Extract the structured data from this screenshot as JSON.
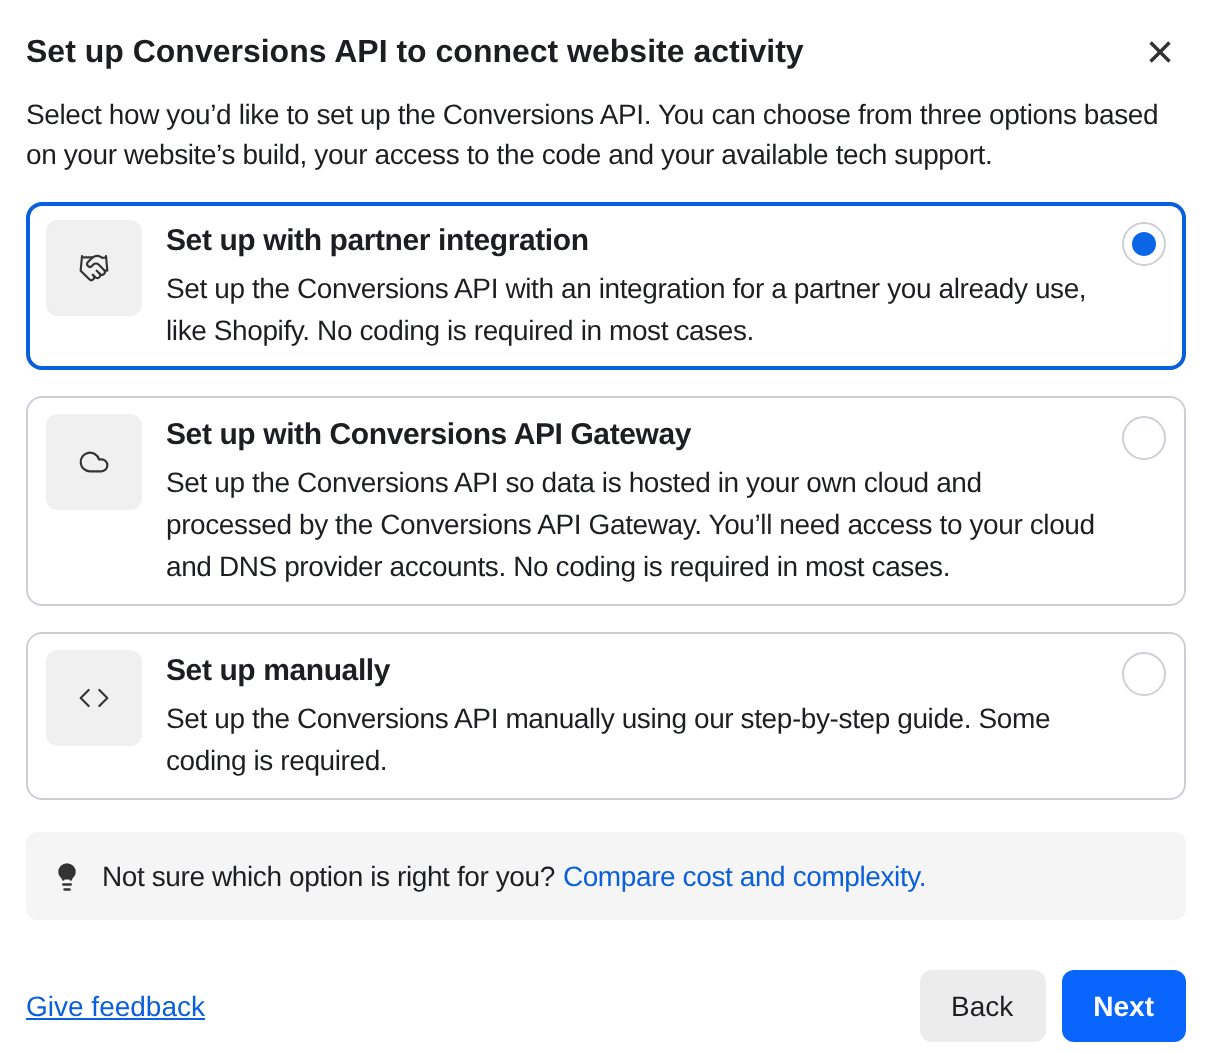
{
  "dialog": {
    "title": "Set up Conversions API to connect website activity",
    "close": "×"
  },
  "intro": "Select how you’d like to set up the Conversions API. You can choose from three options based on your website’s build, your access to the code and your available tech support.",
  "options": [
    {
      "kind": "partner",
      "title": "Set up with partner integration",
      "description": "Set up the Conversions API with an integration for a partner you already use, like Shopify. No coding is required in most cases.",
      "selected": true
    },
    {
      "kind": "gateway",
      "title": "Set up with Conversions API Gateway",
      "description": "Set up the Conversions API so data is hosted in your own cloud and processed by the Conversions API Gateway. You’ll need access to your cloud and DNS provider accounts. No coding is required in most cases.",
      "selected": false
    },
    {
      "kind": "manual",
      "title": "Set up manually",
      "description": "Set up the Conversions API manually using our step-by-step guide. Some coding is required.",
      "selected": false
    }
  ],
  "tip": {
    "text": "Not sure which option is right for you?",
    "link": "Compare cost and complexity."
  },
  "footer": {
    "feedback": "Give feedback",
    "back": "Back",
    "next": "Next"
  }
}
